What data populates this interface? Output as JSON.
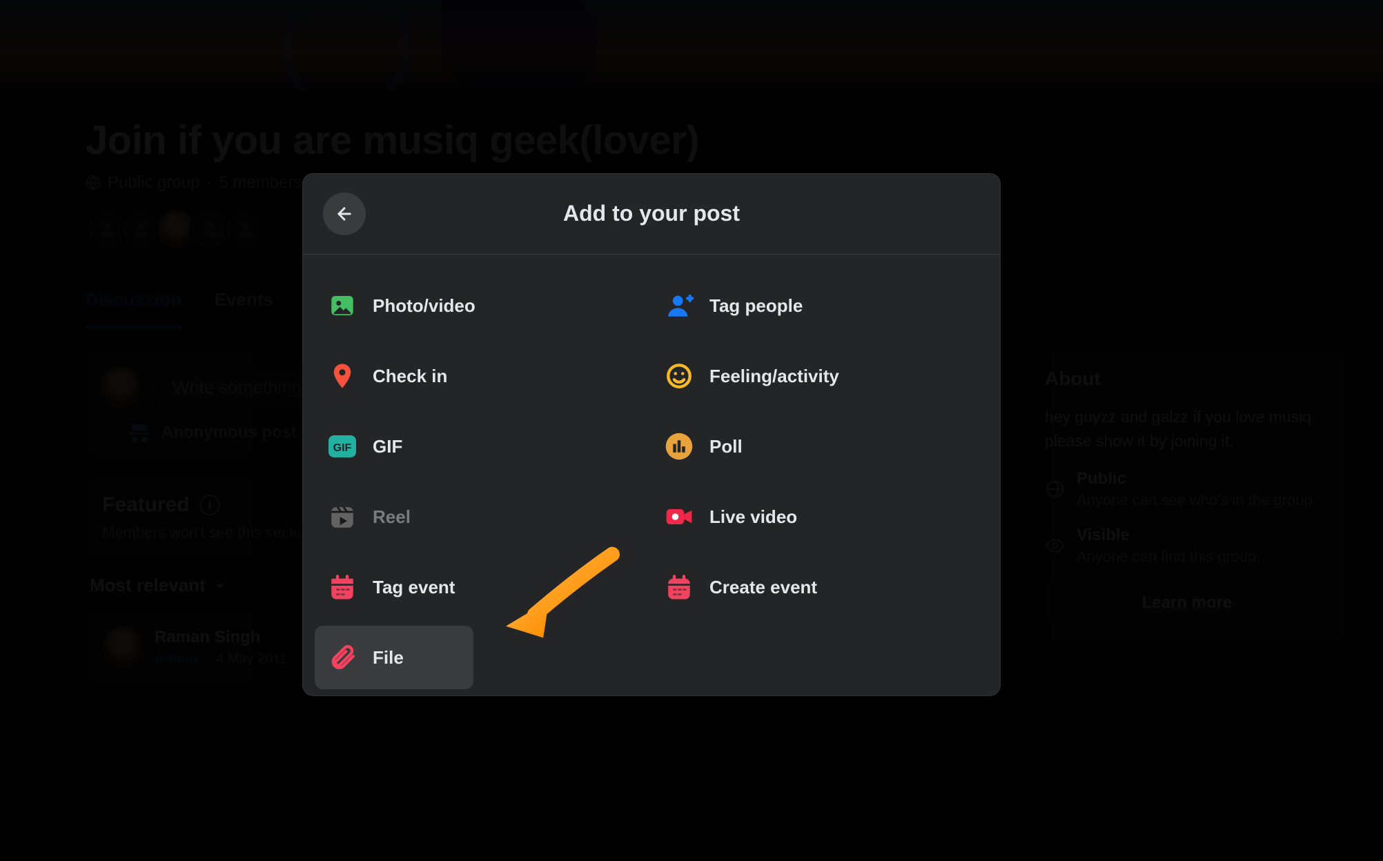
{
  "group": {
    "title": "Join if you are musiq geek(lover)",
    "privacy": "Public group",
    "members_label": "5 members"
  },
  "tabs": {
    "discussion": "Discussion",
    "events": "Events"
  },
  "composer": {
    "placeholder": "Write something...",
    "anonymous_label": "Anonymous post"
  },
  "featured": {
    "title": "Featured",
    "subtitle": "Members won't see this section"
  },
  "sort": {
    "label": "Most relevant"
  },
  "post": {
    "author": "Raman Singh",
    "role": "Admin",
    "date": "4 May 2011"
  },
  "about": {
    "title": "About",
    "description": "hey guyzz and galzz if you love musiq please show it by joining it.",
    "public_title": "Public",
    "public_sub": "Anyone can see who's in the group",
    "visible_title": "Visible",
    "visible_sub": "Anyone can find this group.",
    "learn_more": "Learn more"
  },
  "modal": {
    "title": "Add to your post",
    "options": {
      "photo_video": "Photo/video",
      "tag_people": "Tag people",
      "check_in": "Check in",
      "feeling_activity": "Feeling/activity",
      "gif": "GIF",
      "poll": "Poll",
      "reel": "Reel",
      "live_video": "Live video",
      "tag_event": "Tag event",
      "create_event": "Create event",
      "file": "File"
    }
  },
  "colors": {
    "green": "#45bd62",
    "blue": "#1877f2",
    "red_pin": "#f5533d",
    "yellow": "#f7b928",
    "teal": "#22b0a1",
    "orange_poll": "#e8a33d",
    "pink_red": "#f02849",
    "red_cal": "#f3425f",
    "grey": "#8a8d91",
    "arrow": "#ff9500"
  }
}
